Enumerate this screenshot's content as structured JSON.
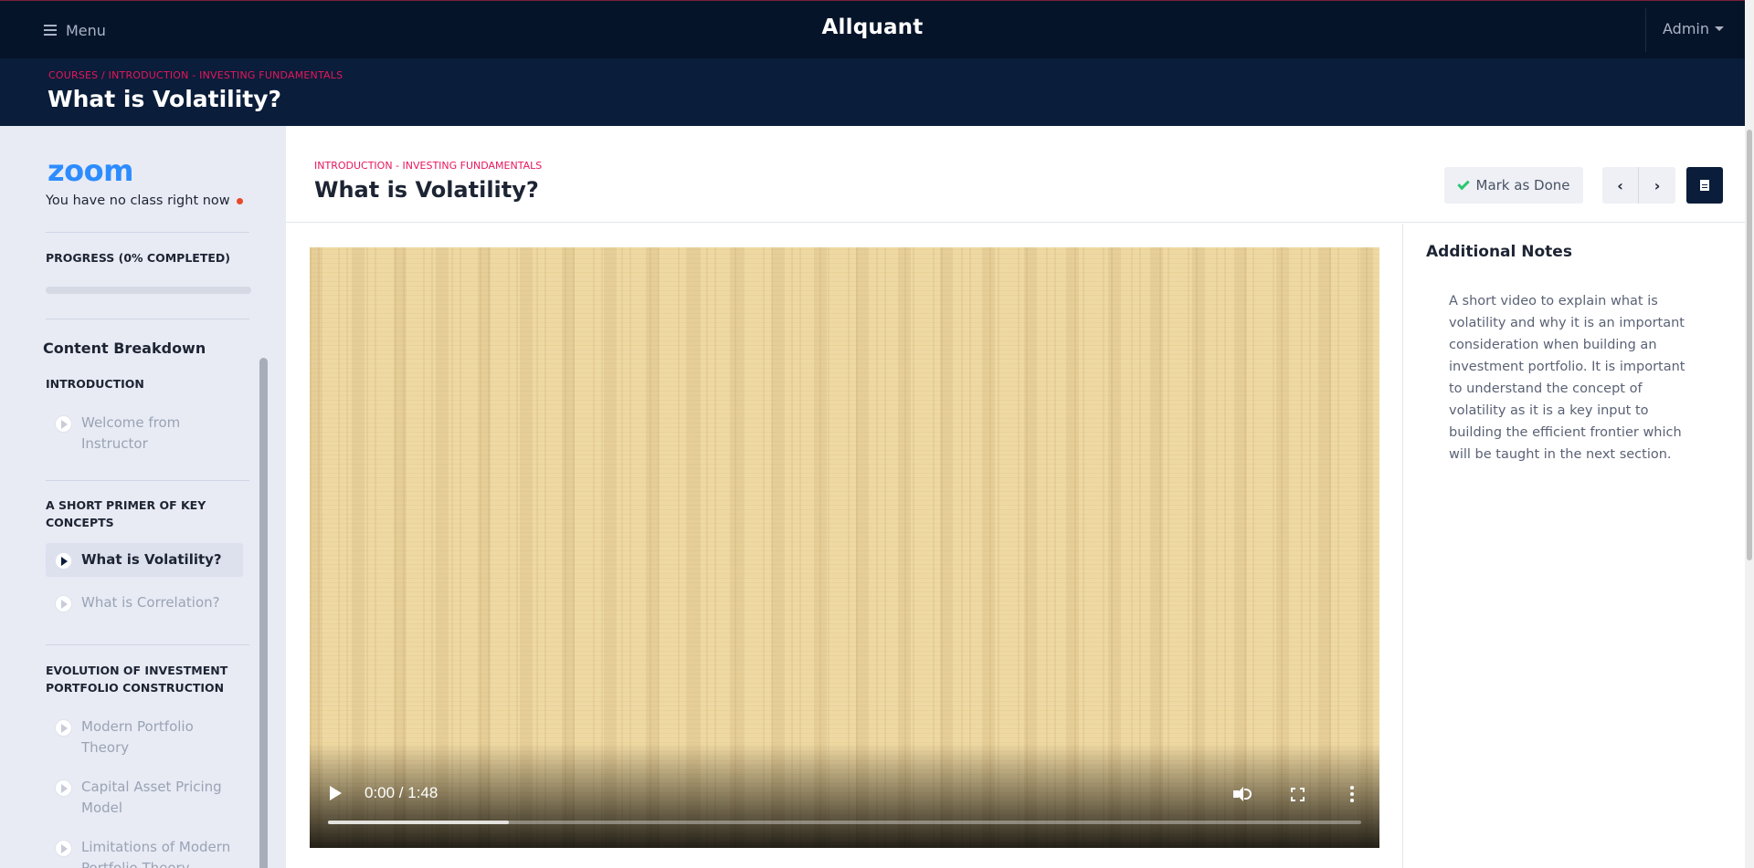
{
  "topbar": {
    "menu_label": "Menu",
    "brand": "Allquant",
    "user_label": "Admin"
  },
  "page_header": {
    "breadcrumb": "COURSES / INTRODUCTION - INVESTING FUNDAMENTALS",
    "title": "What is Volatility?"
  },
  "sidebar": {
    "zoom_logo": "zoom",
    "zoom_status": "You have no class right now",
    "progress_label": "PROGRESS (0% COMPLETED)",
    "progress_fraction": 0.0,
    "breakdown_title": "Content Breakdown",
    "sections": [
      {
        "title": "INTRODUCTION",
        "lessons": [
          {
            "label": "Welcome from Instructor",
            "active": false
          }
        ]
      },
      {
        "title": "A SHORT PRIMER OF KEY CONCEPTS",
        "lessons": [
          {
            "label": "What is Volatility?",
            "active": true
          },
          {
            "label": "What is Correlation?",
            "active": false
          }
        ]
      },
      {
        "title": "EVOLUTION OF INVESTMENT PORTFOLIO CONSTRUCTION",
        "lessons": [
          {
            "label": "Modern Portfolio Theory",
            "active": false
          },
          {
            "label": "Capital Asset Pricing Model",
            "active": false
          },
          {
            "label": "Limitations of Modern Portfolio Theory",
            "active": false
          }
        ]
      }
    ]
  },
  "content": {
    "breadcrumb": "INTRODUCTION - INVESTING FUNDAMENTALS",
    "title": "What is Volatility?",
    "mark_done_label": "Mark as Done",
    "prev_icon": "chevron-left-icon",
    "next_icon": "chevron-right-icon",
    "doc_icon": "document-icon"
  },
  "video": {
    "time": "0:00 / 1:48",
    "buffered_fraction": 0.175
  },
  "notes": {
    "title": "Additional Notes",
    "body": "A short video to explain what is volatility and why it is an important consideration when building an investment portfolio. It is important to understand the concept of volatility as it is a key input to building the efficient frontier which will be taught in the next section."
  },
  "colors": {
    "navbar": "#061429",
    "header": "#0a1d3a",
    "accent_pink": "#e6175c",
    "zoom_blue": "#2d8cff",
    "done_green": "#28c76f"
  }
}
